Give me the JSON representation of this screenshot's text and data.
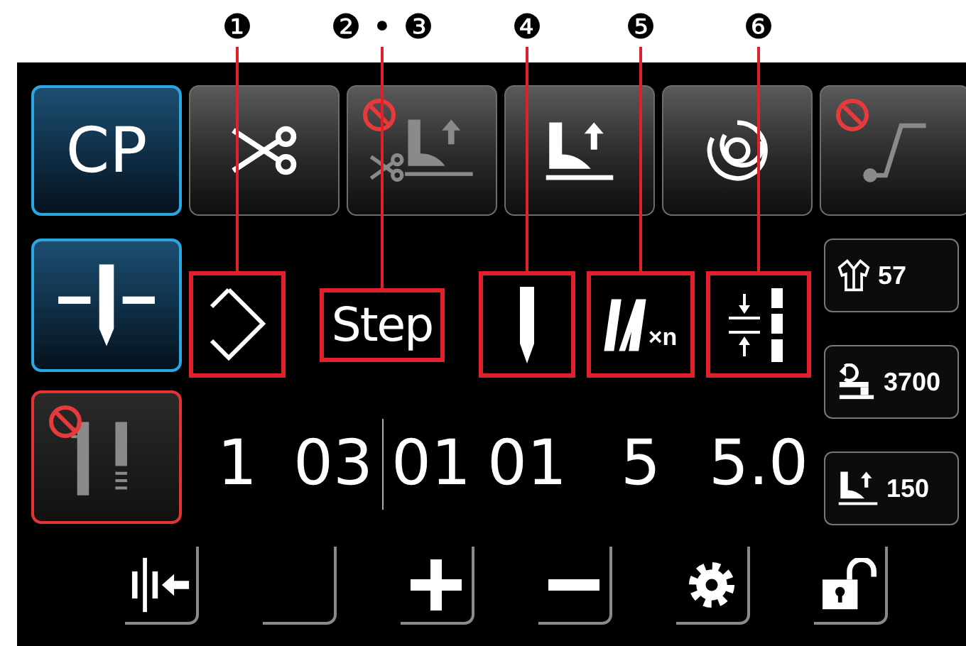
{
  "callouts": [
    {
      "label": "❶"
    },
    {
      "label": "❷ • ❸"
    },
    {
      "label": "❹"
    },
    {
      "label": "❺"
    },
    {
      "label": "❻"
    }
  ],
  "top_buttons": [
    {
      "kind": "text",
      "label": "CP",
      "selected": true,
      "disabled": false
    },
    {
      "kind": "scissors",
      "selected": false,
      "disabled": false
    },
    {
      "kind": "scissors-foot",
      "selected": false,
      "disabled": true
    },
    {
      "kind": "foot-lift",
      "selected": false,
      "disabled": false
    },
    {
      "kind": "spiral",
      "selected": false,
      "disabled": false
    },
    {
      "kind": "curve",
      "selected": false,
      "disabled": true
    }
  ],
  "side_buttons": [
    {
      "kind": "needle-mode",
      "selected": true,
      "disabled": false
    },
    {
      "kind": "stitch",
      "selected": false,
      "disabled": true
    }
  ],
  "parameters": [
    {
      "kind": "shape",
      "values": [
        "1"
      ]
    },
    {
      "kind": "text",
      "label": "Step",
      "values": [
        "03",
        "01"
      ]
    },
    {
      "kind": "needle",
      "values": [
        "01"
      ]
    },
    {
      "kind": "repeat",
      "label": "×n",
      "values": [
        "5"
      ]
    },
    {
      "kind": "pitch",
      "values": [
        "5.0"
      ]
    }
  ],
  "counters": [
    {
      "kind": "shirt",
      "value": "57"
    },
    {
      "kind": "machine",
      "value": "3700"
    },
    {
      "kind": "foot",
      "value": "150"
    }
  ],
  "bottom_buttons": [
    {
      "kind": "align"
    },
    {
      "kind": "blank"
    },
    {
      "kind": "plus"
    },
    {
      "kind": "minus"
    },
    {
      "kind": "gear"
    },
    {
      "kind": "unlock"
    }
  ]
}
